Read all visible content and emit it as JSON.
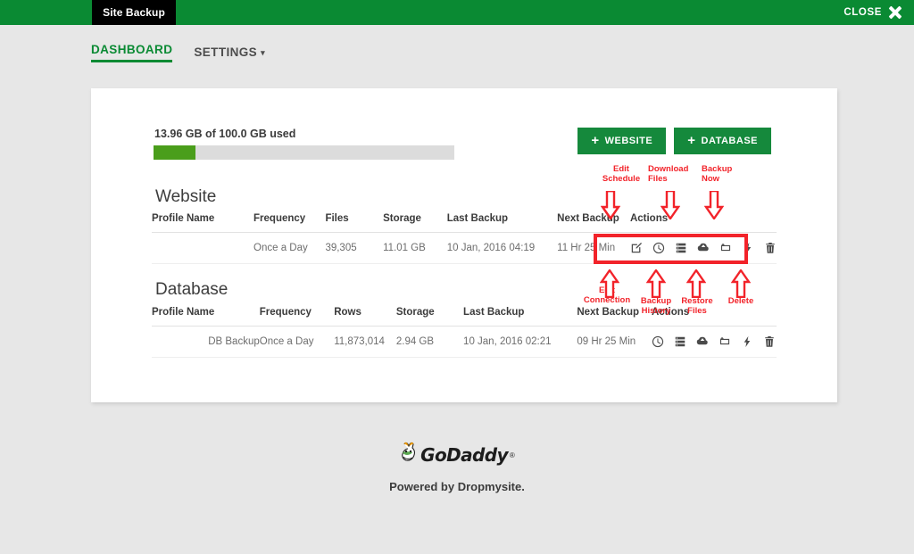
{
  "titlebar": {
    "app_tab_label": "Site Backup",
    "close_label": "CLOSE",
    "close_icon": "close-x-icon",
    "bar_color": "#0a8a33",
    "tab_color": "#000000"
  },
  "nav": {
    "items": [
      {
        "label": "DASHBOARD",
        "active": true
      },
      {
        "label": "SETTINGS",
        "active": false,
        "caret": "▾"
      }
    ]
  },
  "quota": {
    "label": "13.96 GB of 100.0 GB used",
    "used_gb": 13.96,
    "total_gb": 100.0,
    "percent": 13.96,
    "fill_color": "#4a9e1b",
    "track_color": "#dcdcdc"
  },
  "actions_buttons": [
    {
      "label": "WEBSITE",
      "icon": "plus-icon",
      "color": "#15893c"
    },
    {
      "label": "DATABASE",
      "icon": "plus-icon",
      "color": "#15893c"
    }
  ],
  "website": {
    "title": "Website",
    "columns": [
      "Profile Name",
      "Frequency",
      "Files",
      "Storage",
      "Last Backup",
      "Next Backup",
      "Actions"
    ],
    "rows": [
      {
        "profile_name": "",
        "frequency": "Once a Day",
        "files": "39,305",
        "storage": "11.01 GB",
        "last_backup": "10 Jan, 2016 04:19",
        "next_backup": "11 Hr 25 Min",
        "action_icons": [
          "edit-schedule-icon",
          "clock-icon",
          "backup-history-icon",
          "download-files-icon",
          "restore-files-icon",
          "backup-now-icon",
          "delete-icon"
        ]
      }
    ]
  },
  "database": {
    "title": "Database",
    "columns": [
      "Profile Name",
      "Frequency",
      "Rows",
      "Storage",
      "Last Backup",
      "Next Backup",
      "Actions"
    ],
    "rows": [
      {
        "profile_name": "DB Backup",
        "frequency": "Once a Day",
        "rows_count": "11,873,014",
        "storage": "2.94 GB",
        "last_backup": "10 Jan, 2016 02:21",
        "next_backup": "09 Hr 25 Min",
        "action_icons": [
          "clock-icon",
          "backup-history-icon",
          "download-files-icon",
          "restore-files-icon",
          "backup-now-icon",
          "delete-icon"
        ]
      }
    ]
  },
  "annotations": {
    "color": "#f2232a",
    "above": [
      {
        "line1": "Edit",
        "line2": "Schedule"
      },
      {
        "line1": "Download",
        "line2": "Files"
      },
      {
        "line1": "Backup",
        "line2": "Now"
      }
    ],
    "below": [
      {
        "line1": "Edit",
        "line2": "Connection"
      },
      {
        "line1": "Backup",
        "line2": "History"
      },
      {
        "line1": "Restore",
        "line2": "Files"
      },
      {
        "line1": "Delete",
        "line2": ""
      }
    ]
  },
  "footer": {
    "logo_text": "GoDaddy",
    "logo_tm": "®",
    "powered_by": "Powered by Dropmysite."
  }
}
